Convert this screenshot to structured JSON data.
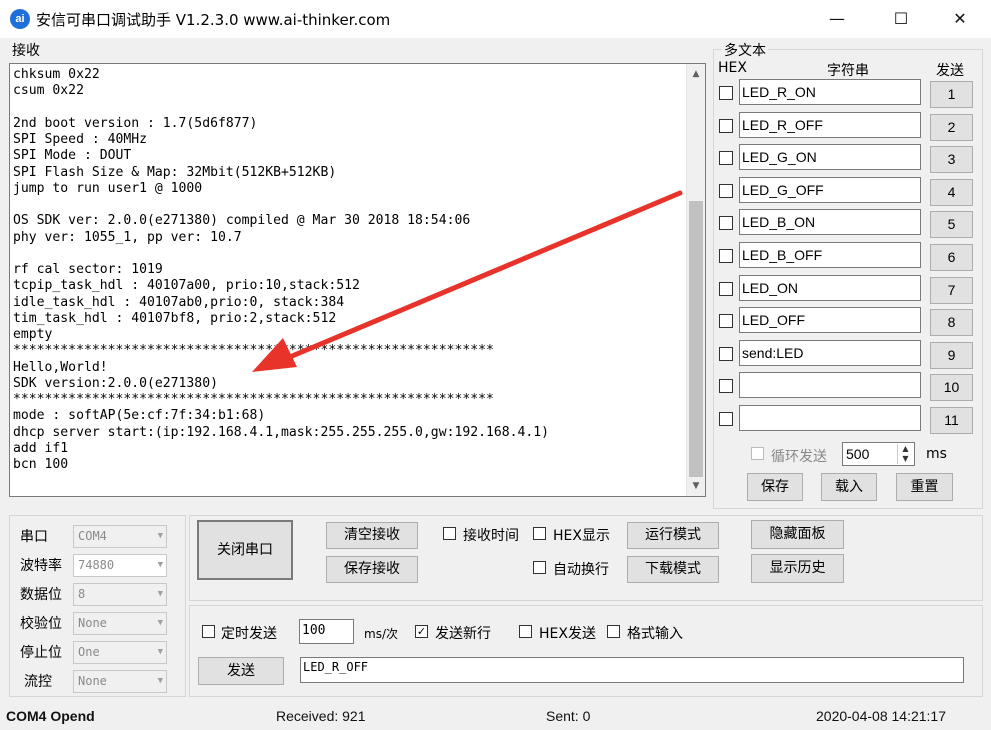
{
  "window": {
    "icon_text": "ai",
    "title": "安信可串口调试助手 V1.2.3.0    www.ai-thinker.com",
    "min_glyph": "—",
    "max_glyph": "☐",
    "close_glyph": "✕"
  },
  "receive": {
    "label": "接收",
    "lines": [
      "chksum 0x22",
      "csum 0x22",
      "",
      "2nd boot version : 1.7(5d6f877)",
      "SPI Speed : 40MHz",
      "SPI Mode : DOUT",
      "SPI Flash Size & Map: 32Mbit(512KB+512KB)",
      "jump to run user1 @ 1000",
      "",
      "OS SDK ver: 2.0.0(e271380) compiled @ Mar 30 2018 18:54:06",
      "phy ver: 1055_1, pp ver: 10.7",
      "",
      "rf cal sector: 1019",
      "tcpip_task_hdl : 40107a00, prio:10,stack:512",
      "idle_task_hdl : 40107ab0,prio:0, stack:384",
      "tim_task_hdl : 40107bf8, prio:2,stack:512",
      "empty",
      "*************************************************************",
      "Hello,World!",
      "SDK version:2.0.0(e271380)",
      "*************************************************************",
      "mode : softAP(5e:cf:7f:34:b1:68)",
      "dhcp server start:(ip:192.168.4.1,mask:255.255.255.0,gw:192.168.4.1)",
      "add if1",
      "bcn 100"
    ]
  },
  "multitext": {
    "title": "多文本",
    "hex_header": "HEX",
    "string_header": "字符串",
    "send_header": "发送",
    "rows": [
      {
        "text": "LED_R_ON",
        "button": "1"
      },
      {
        "text": "LED_R_OFF",
        "button": "2"
      },
      {
        "text": "LED_G_ON",
        "button": "3"
      },
      {
        "text": "LED_G_OFF",
        "button": "4"
      },
      {
        "text": "LED_B_ON",
        "button": "5"
      },
      {
        "text": "LED_B_OFF",
        "button": "6"
      },
      {
        "text": "LED_ON",
        "button": "7"
      },
      {
        "text": "LED_OFF",
        "button": "8"
      },
      {
        "text": "send:LED",
        "button": "9"
      },
      {
        "text": "",
        "button": "10"
      },
      {
        "text": "",
        "button": "11"
      }
    ],
    "loop_send_label": "循环发送",
    "loop_interval": "500",
    "loop_unit": "ms",
    "save_label": "保存",
    "load_label": "载入",
    "reset_label": "重置"
  },
  "serial_settings": {
    "port_label": "串口",
    "port_value": "COM4",
    "baud_label": "波特率",
    "baud_value": "74880",
    "databits_label": "数据位",
    "databits_value": "8",
    "parity_label": "校验位",
    "parity_value": "None",
    "stopbits_label": "停止位",
    "stopbits_value": "One",
    "flow_label": "流控",
    "flow_value": "None"
  },
  "controls": {
    "close_port": "关闭串口",
    "clear_receive": "清空接收",
    "save_receive": "保存接收",
    "recv_time": "接收时间",
    "hex_display": "HEX显示",
    "auto_wrap": "自动换行",
    "run_mode": "运行模式",
    "download_mode": "下载模式",
    "hide_panel": "隐藏面板",
    "show_history": "显示历史"
  },
  "send": {
    "timed_send": "定时发送",
    "interval": "100",
    "interval_unit": "ms/次",
    "new_line": "发送新行",
    "new_line_checked": true,
    "new_line_mark": "✓",
    "hex_send": "HEX发送",
    "format_input": "格式输入",
    "send_button": "发送",
    "send_text": "LED_R_OFF"
  },
  "status": {
    "port_state": "COM4 Opend",
    "received": "Received: 921",
    "sent": "Sent: 0",
    "datetime": "2020-04-08 14:21:17"
  },
  "colors": {
    "annotation_arrow": "#e8332a",
    "app_icon": "#1e6fd9"
  }
}
